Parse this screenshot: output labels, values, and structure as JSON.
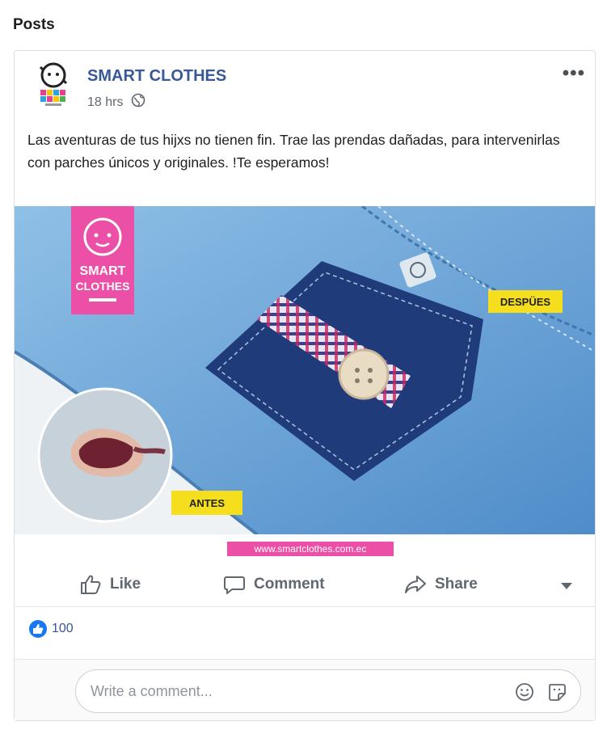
{
  "section": {
    "title": "Posts"
  },
  "post": {
    "page_name": "SMART CLOTHES",
    "time": "18 hrs",
    "privacy_icon": "globe-icon",
    "more_label": "•••",
    "text": "Las aventuras de tus hijxs no tienen fin. Trae las prendas dañadas, para intervenirlas con parches únicos y originales. !Te esperamos!",
    "image": {
      "logo_text_line1": "SMART",
      "logo_text_line2": "CLOTHES",
      "label_after": "DESPÜES",
      "label_before": "ANTES",
      "website": "www.smartclothes.com.ec"
    }
  },
  "actions": {
    "like_label": "Like",
    "comment_label": "Comment",
    "share_label": "Share"
  },
  "reactions": {
    "count": "100"
  },
  "comment": {
    "placeholder": "Write a comment..."
  },
  "colors": {
    "brand_pink": "#ec4fa6",
    "label_yellow": "#f5de1e",
    "link_blue": "#385898",
    "like_blue": "#1877f2"
  }
}
